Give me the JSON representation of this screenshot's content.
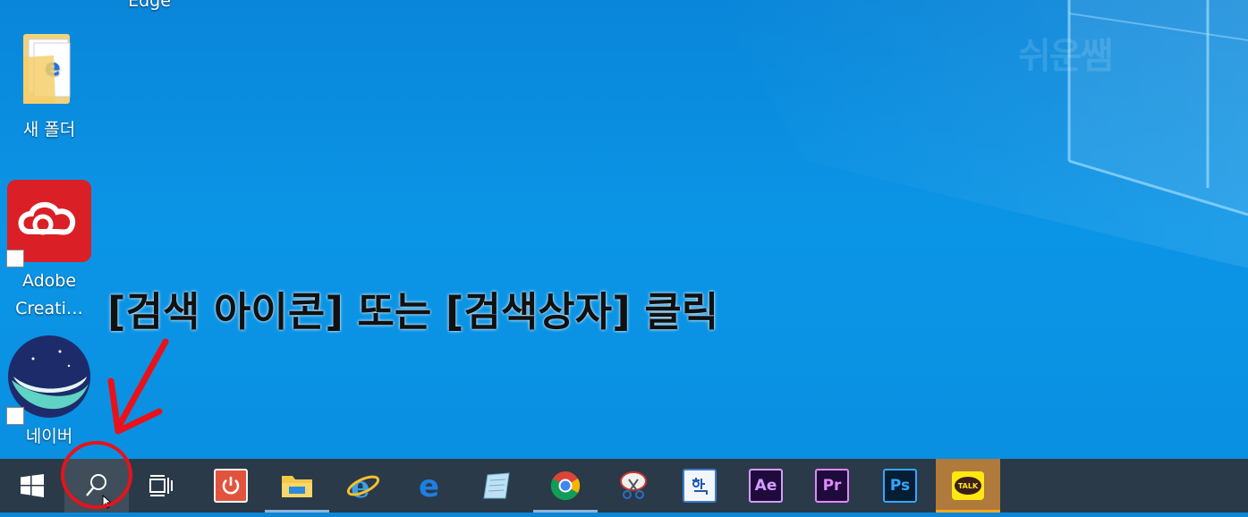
{
  "desktop": {
    "top_label": "Edge",
    "watermark": "쉬운쌤",
    "icons": [
      {
        "label": "새 폴더",
        "icon": "folder-icon"
      },
      {
        "label": "Adobe",
        "label2": "Creati…",
        "icon": "adobe-creative-cloud-icon"
      },
      {
        "label": "네이버",
        "icon": "naver-whale-icon"
      }
    ],
    "instruction": "[검색 아이콘] 또는 [검색상자] 클릭"
  },
  "taskbar": {
    "items": [
      {
        "name": "start-button",
        "icon": "windows-logo-icon"
      },
      {
        "name": "search-button",
        "icon": "search-icon"
      },
      {
        "name": "task-view-button",
        "icon": "task-view-icon"
      },
      {
        "name": "power-app",
        "icon": "power-icon"
      },
      {
        "name": "file-explorer",
        "icon": "folder-icon"
      },
      {
        "name": "internet-explorer",
        "icon": "ie-icon"
      },
      {
        "name": "edge",
        "icon": "edge-icon"
      },
      {
        "name": "notepad",
        "icon": "notepad-icon"
      },
      {
        "name": "chrome",
        "icon": "chrome-icon"
      },
      {
        "name": "snipping-tool",
        "icon": "scissors-icon"
      },
      {
        "name": "hangul",
        "icon": "hangul-icon"
      },
      {
        "name": "after-effects",
        "icon": "ae-icon",
        "text": "Ae"
      },
      {
        "name": "premiere",
        "icon": "pr-icon",
        "text": "Pr"
      },
      {
        "name": "photoshop",
        "icon": "ps-icon",
        "text": "Ps"
      },
      {
        "name": "kakaotalk",
        "icon": "kakaotalk-icon",
        "text": "TALK"
      }
    ]
  },
  "colors": {
    "desktop_bg": "#0b95e6",
    "taskbar_bg": "#2a3a48",
    "annotation_red": "#e8121b",
    "kakao_bg": "#b07a3c"
  }
}
